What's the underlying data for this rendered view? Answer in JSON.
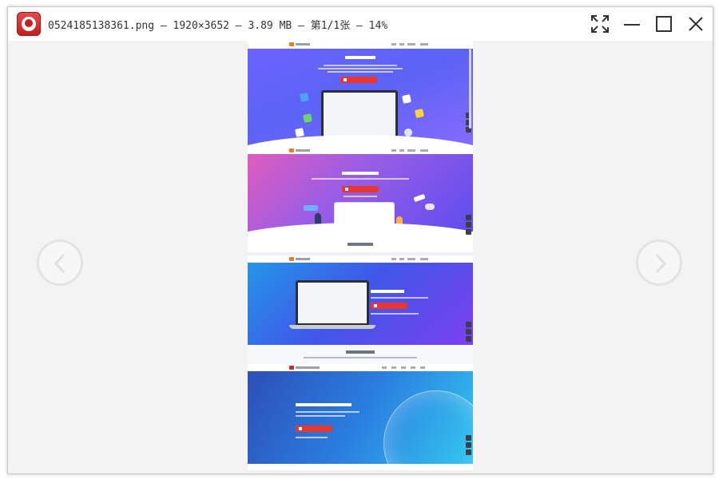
{
  "window": {
    "title": "0524185138361.png — 1920×3652 — 3.89 MB — 第1/1张 — 14%",
    "controls": [
      "fullscreen",
      "minimize",
      "maximize",
      "close"
    ]
  },
  "viewer": {
    "prev_label": "‹",
    "next_label": "›"
  },
  "colors": {
    "app_icon": "#d12b2b",
    "section1_bg": "#5b63f5",
    "section2_bg": "#9b5de5",
    "section3_bg": "#2f6fe8",
    "section4_bg": "#2a7ee0",
    "download_button": "#e8372f"
  },
  "icons": {
    "app": "app-logo-icon",
    "fullscreen": "fullscreen-icon",
    "minimize": "minimize-icon",
    "maximize": "maximize-icon",
    "close": "close-icon",
    "prev": "chevron-left-icon",
    "next": "chevron-right-icon"
  }
}
